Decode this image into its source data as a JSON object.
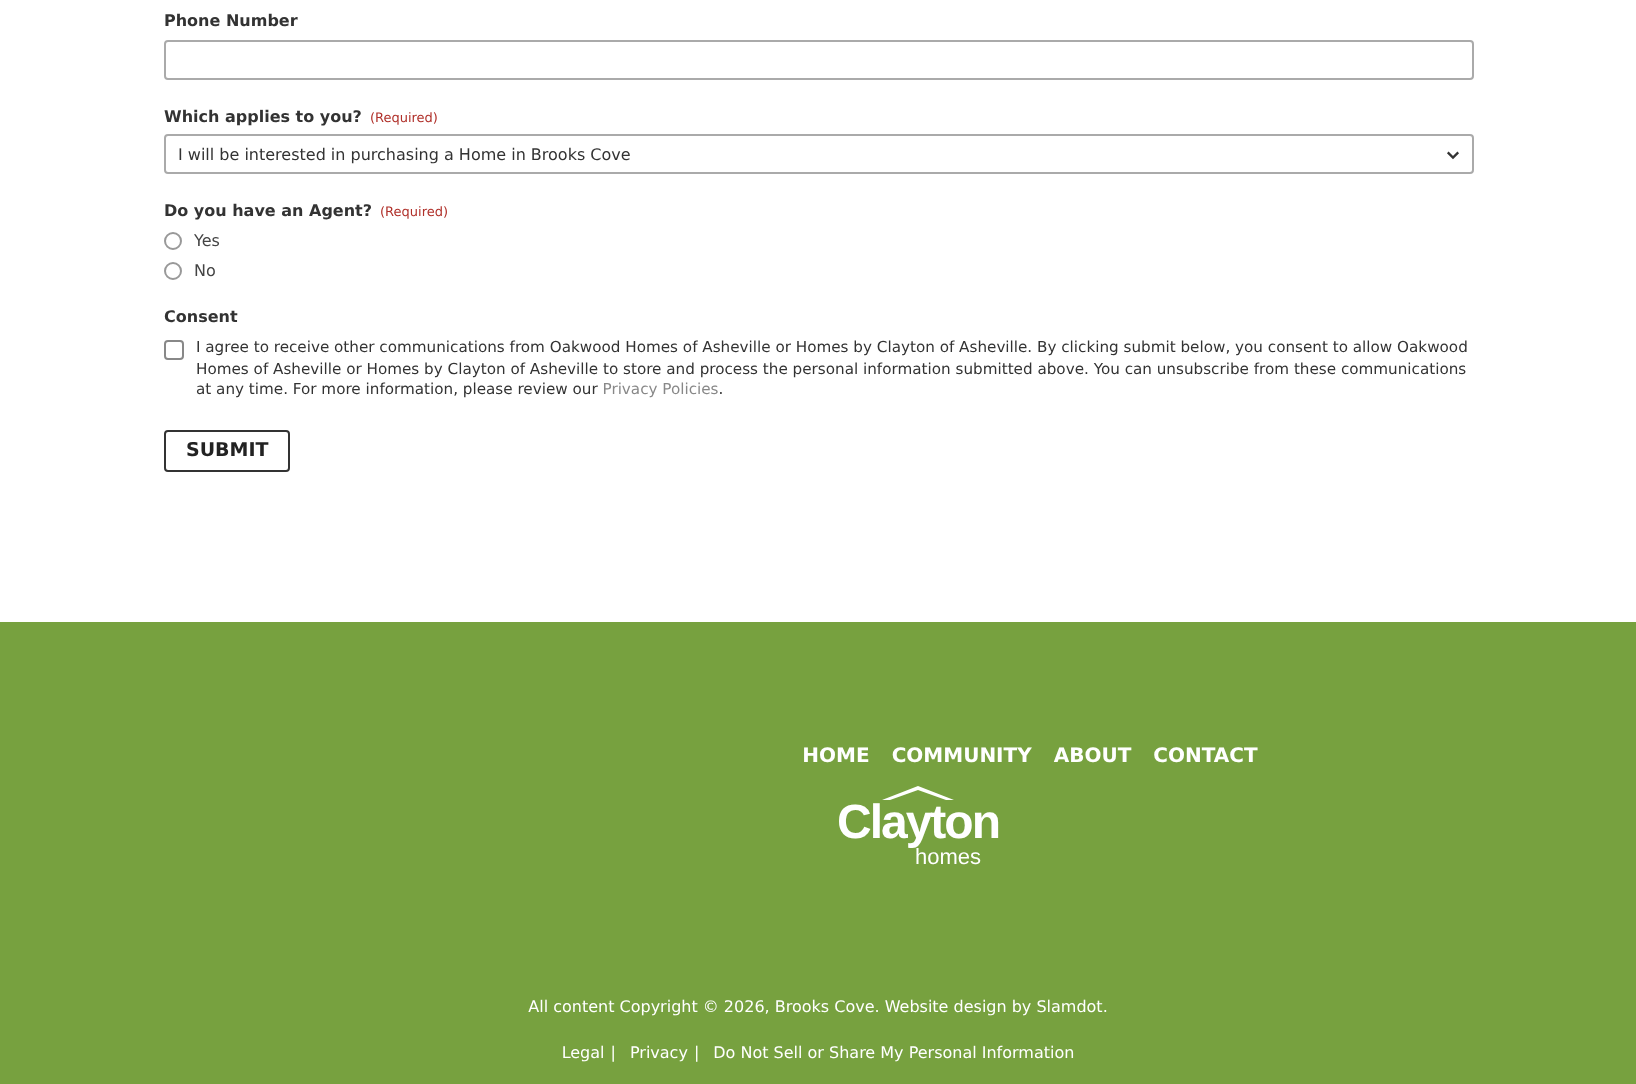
{
  "form": {
    "phone": {
      "label": "Phone Number"
    },
    "applies": {
      "label": "Which applies to you?",
      "required": "(Required)",
      "value": "I will be interested in purchasing a Home in Brooks Cove"
    },
    "agent": {
      "label": "Do you have an Agent?",
      "required": "(Required)",
      "options": [
        {
          "label": "Yes",
          "selected": false
        },
        {
          "label": "No",
          "selected": false
        }
      ]
    },
    "consent": {
      "label": "Consent",
      "checked": false,
      "text": "I agree to receive other communications from Oakwood Homes of Asheville or Homes by Clayton of Asheville. By clicking submit below, you consent to allow Oakwood Homes of Asheville or Homes by Clayton of Asheville to store and process the personal information submitted above. You can unsubscribe from these communications at any time. For more information, please review our",
      "link": "Privacy Policies",
      "end": "."
    },
    "submit": "SUBMIT"
  },
  "footer": {
    "nav": [
      "HOME",
      "COMMUNITY",
      "ABOUT",
      "CONTACT"
    ],
    "logo": {
      "name": "Clayton",
      "sub": "homes"
    },
    "copyright": "All content Copyright © 2026, Brooks Cove. Website design by Slamdot.",
    "links": [
      {
        "label": "Legal"
      },
      {
        "label": "Privacy"
      },
      {
        "label": "Do Not Sell or Share My Personal Information"
      }
    ],
    "separators": [
      "|",
      "|"
    ]
  }
}
